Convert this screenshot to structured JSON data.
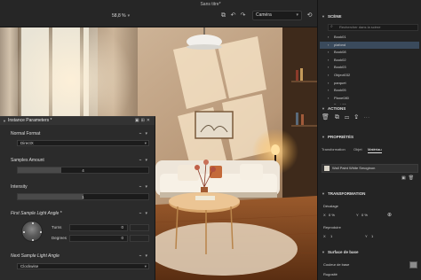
{
  "window": {
    "title": "Sans titre*"
  },
  "toolbar": {
    "zoom": "58,8 %",
    "camera": "Caméra",
    "icons": [
      "snap-icon",
      "undo-icon",
      "redo-icon",
      "reset-icon"
    ]
  },
  "instance_panel": {
    "title": "Instance Parameters *",
    "params": [
      {
        "label": "Normal Format",
        "value": "DirectX"
      },
      {
        "label": "Samples Amount",
        "value": "4",
        "fraction": 0.33
      },
      {
        "label": "Intensity",
        "value": "1",
        "fraction": 0.5
      },
      {
        "label": "First Sample Light Angle *",
        "turns_label": "Turns",
        "turns": "0",
        "degrees_label": "Degrees",
        "degrees": "0"
      },
      {
        "label": "Next Sample Light Angle",
        "value": "Clockwise"
      }
    ]
  },
  "sidebar": {
    "scene": {
      "title": "SCÈNE",
      "search_placeholder": "Rechercher dans la scène",
      "items": [
        "Book01",
        "plafond",
        "Book08",
        "Book02",
        "Book03",
        "Object032",
        "parquet",
        "Book05",
        "Plane080",
        "Book03"
      ],
      "selected_index": 1
    },
    "actions": {
      "title": "ACTIONS"
    },
    "properties": {
      "title": "PROPRIÉTÉS",
      "tabs": [
        "Transformation",
        "Objet",
        "Matériau"
      ],
      "active_tab": 2,
      "material": "Wall Paint White Smoginon"
    },
    "transformation": {
      "title": "TRANSFORMATION",
      "offset_label": "Décalage",
      "x_label": "X",
      "x_value": "0 %",
      "y_label": "Y",
      "y_value": "0 %",
      "repeat_label": "Reproduire",
      "rx_label": "X",
      "rx_value": "1",
      "ry_label": "Y",
      "ry_value": "1"
    },
    "surface": {
      "title": "Surface de base",
      "color_label": "Couleur de base",
      "roughness_label": "Rugosité",
      "swatch": "#8c8c8c"
    }
  }
}
